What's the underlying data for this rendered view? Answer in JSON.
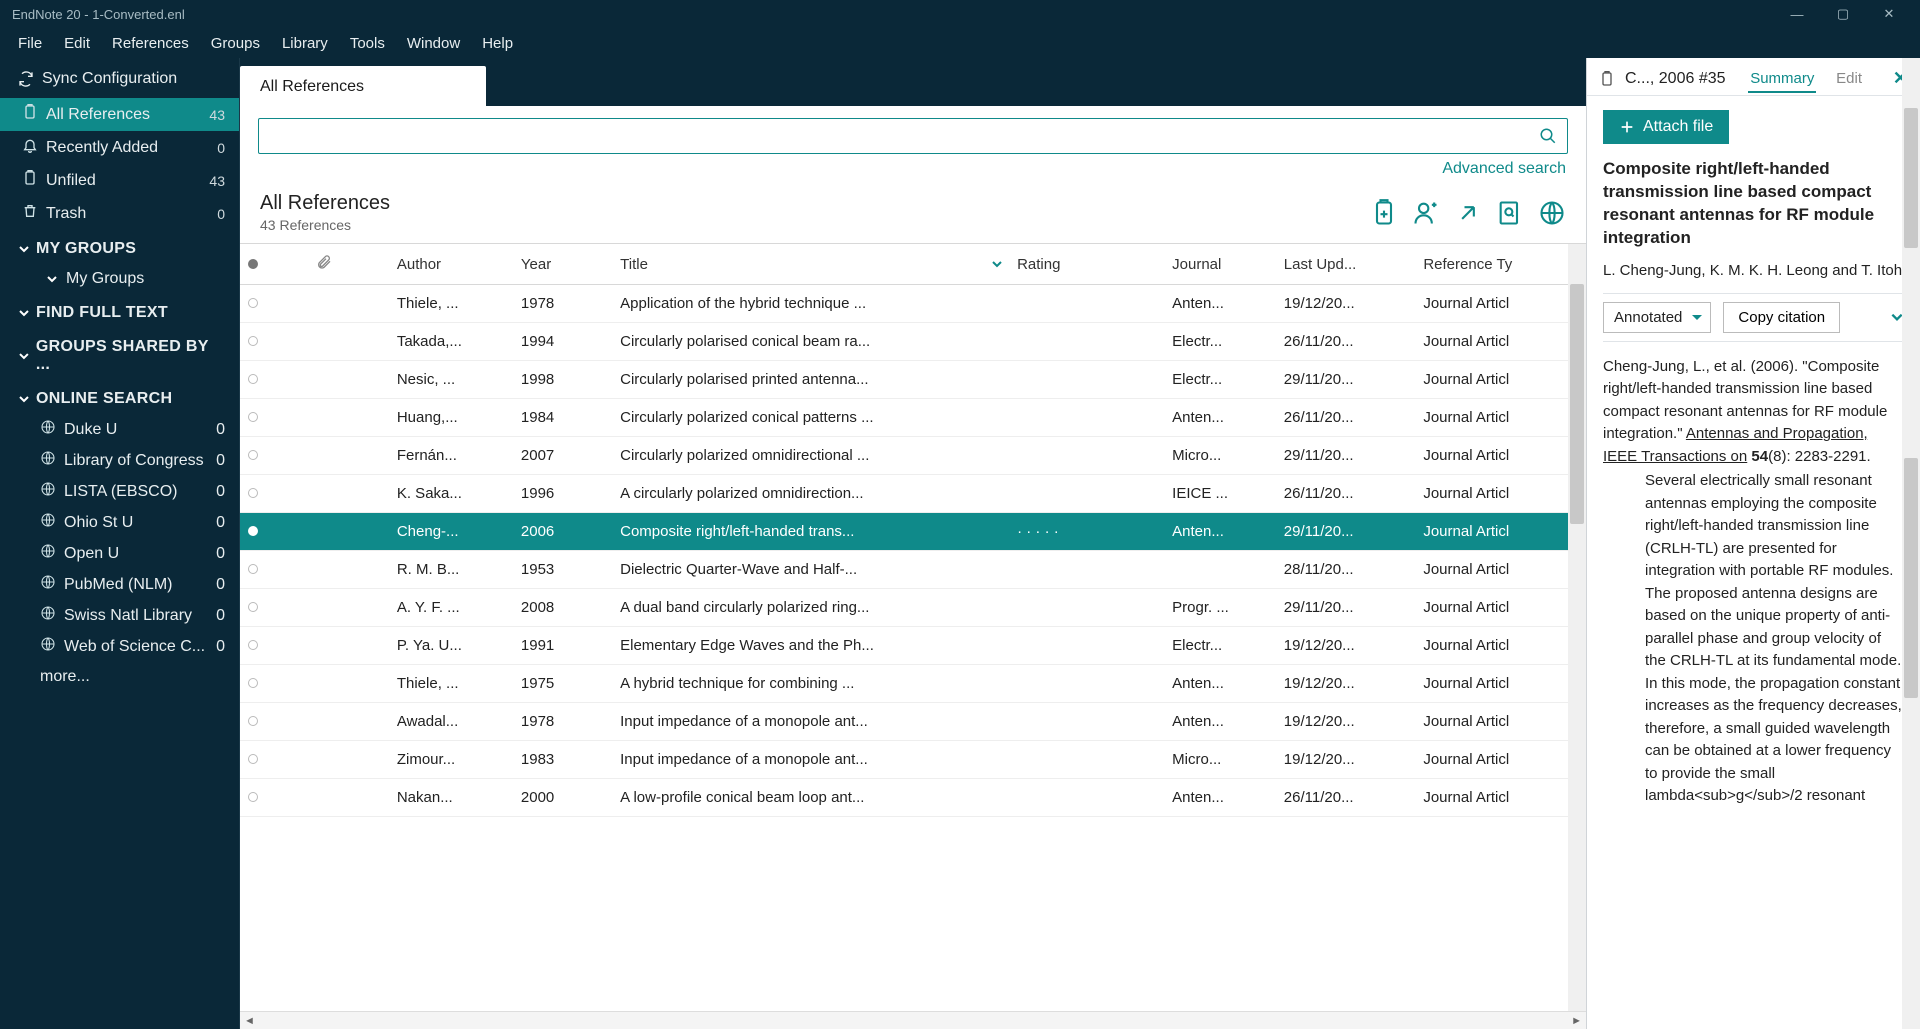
{
  "window": {
    "title": "EndNote 20 - 1-Converted.enl"
  },
  "menu": [
    "File",
    "Edit",
    "References",
    "Groups",
    "Library",
    "Tools",
    "Window",
    "Help"
  ],
  "sidebar": {
    "sync": "Sync Configuration",
    "library": [
      {
        "icon": "clipboard",
        "label": "All References",
        "count": 43,
        "selected": true
      },
      {
        "icon": "bell",
        "label": "Recently Added",
        "count": 0
      },
      {
        "icon": "clipboard",
        "label": "Unfiled",
        "count": 43
      },
      {
        "icon": "trash",
        "label": "Trash",
        "count": 0
      }
    ],
    "heads": {
      "mygroups": "MY GROUPS",
      "mygroups_child": "My Groups",
      "findfull": "FIND FULL TEXT",
      "shared": "GROUPS SHARED BY ...",
      "online": "ONLINE SEARCH"
    },
    "online": [
      {
        "label": "Duke U",
        "count": 0
      },
      {
        "label": "Library of Congress",
        "count": 0
      },
      {
        "label": "LISTA (EBSCO)",
        "count": 0
      },
      {
        "label": "Ohio St U",
        "count": 0
      },
      {
        "label": "Open U",
        "count": 0
      },
      {
        "label": "PubMed (NLM)",
        "count": 0
      },
      {
        "label": "Swiss Natl Library",
        "count": 0
      },
      {
        "label": "Web of Science C...",
        "count": 0
      }
    ],
    "more": "more..."
  },
  "tab": "All References",
  "advanced": "Advanced search",
  "heading": "All References",
  "subheading": "43 References",
  "columns": [
    "",
    "",
    "Author",
    "Year",
    "Title",
    "Rating",
    "Journal",
    "Last Upd...",
    "Reference Ty"
  ],
  "rows": [
    {
      "a": "Thiele, ...",
      "y": "1978",
      "t": "Application of the hybrid technique ...",
      "j": "Anten...",
      "u": "19/12/20...",
      "r": "Journal Articl"
    },
    {
      "a": "Takada,...",
      "y": "1994",
      "t": "Circularly polarised conical beam ra...",
      "j": "Electr...",
      "u": "26/11/20...",
      "r": "Journal Articl"
    },
    {
      "a": "Nesic, ...",
      "y": "1998",
      "t": "Circularly polarised printed antenna...",
      "j": "Electr...",
      "u": "29/11/20...",
      "r": "Journal Articl"
    },
    {
      "a": "Huang,...",
      "y": "1984",
      "t": "Circularly polarized conical patterns ...",
      "j": "Anten...",
      "u": "26/11/20...",
      "r": "Journal Articl"
    },
    {
      "a": "Fernán...",
      "y": "2007",
      "t": "Circularly polarized omnidirectional ...",
      "j": "Micro...",
      "u": "29/11/20...",
      "r": "Journal Articl"
    },
    {
      "a": "K. Saka...",
      "y": "1996",
      "t": "A circularly polarized omnidirection...",
      "j": "IEICE ...",
      "u": "26/11/20...",
      "r": "Journal Articl"
    },
    {
      "a": "Cheng-...",
      "y": "2006",
      "t": "Composite right/left-handed trans...",
      "j": "Anten...",
      "u": "29/11/20...",
      "r": "Journal Articl",
      "selected": true,
      "rating": "·   ·   ·   ·   ·"
    },
    {
      "a": "R. M. B...",
      "y": "1953",
      "t": "Dielectric Quarter-Wave and Half-...",
      "j": "",
      "u": "28/11/20...",
      "r": "Journal Articl"
    },
    {
      "a": "A. Y. F. ...",
      "y": "2008",
      "t": "A dual band circularly polarized ring...",
      "j": "Progr. ...",
      "u": "29/11/20...",
      "r": "Journal Articl"
    },
    {
      "a": "P. Ya. U...",
      "y": "1991",
      "t": "Elementary Edge Waves and the Ph...",
      "j": "Electr...",
      "u": "19/12/20...",
      "r": "Journal Articl"
    },
    {
      "a": "Thiele, ...",
      "y": "1975",
      "t": "A hybrid technique for combining ...",
      "j": "Anten...",
      "u": "19/12/20...",
      "r": "Journal Articl"
    },
    {
      "a": "Awadal...",
      "y": "1978",
      "t": "Input impedance of a monopole ant...",
      "j": "Anten...",
      "u": "19/12/20...",
      "r": "Journal Articl"
    },
    {
      "a": "Zimour...",
      "y": "1983",
      "t": "Input impedance of a monopole ant...",
      "j": "Micro...",
      "u": "19/12/20...",
      "r": "Journal Articl"
    },
    {
      "a": "Nakan...",
      "y": "2000",
      "t": "A low-profile conical beam loop ant...",
      "j": "Anten...",
      "u": "26/11/20...",
      "r": "Journal Articl"
    }
  ],
  "details": {
    "crumb": "C..., 2006 #35",
    "tabs": {
      "summary": "Summary",
      "edit": "Edit"
    },
    "attach": "Attach file",
    "title": "Composite right/left-handed transmission line based compact resonant antennas for RF module integration",
    "authors": "L. Cheng-Jung, K. M. K. H. Leong and T. Itoh",
    "styleSel": "Annotated",
    "copy": "Copy citation",
    "cite_pre": "Cheng-Jung, L., et al. (2006). \"Composite right/left-handed transmission line based compact resonant antennas for RF module integration.\" ",
    "cite_journal": "Antennas and Propagation, IEEE Transactions on",
    "cite_loc_pre": " ",
    "cite_vol": "54",
    "cite_loc": "(8): 2283-2291.",
    "abstract": "Several electrically small resonant antennas employing the composite right/left-handed transmission line (CRLH-TL) are presented for integration with portable RF modules. The proposed antenna designs are based on the unique property of anti-parallel phase and group velocity of the CRLH-TL at its fundamental mode. In this mode, the propagation constant increases as the frequency decreases, therefore, a small guided wavelength can be obtained at a lower frequency to provide the small lambda<sub>g</sub>/2 resonant"
  }
}
